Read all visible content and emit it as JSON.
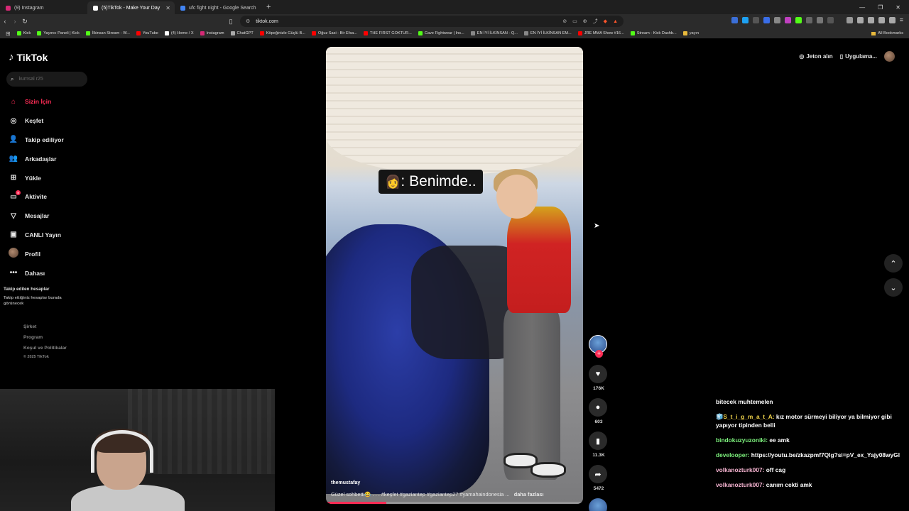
{
  "browser": {
    "tabs": [
      {
        "title": "(9) Instagram",
        "active": false,
        "color": "#d62976"
      },
      {
        "title": "(5)TikTok - Make Your Day",
        "active": true,
        "color": "#ffffff"
      },
      {
        "title": "ufc fight night - Google Search",
        "active": false,
        "color": "#4285f4"
      }
    ],
    "new_tab": "+",
    "url": "tiktok.com",
    "bookmarks": [
      {
        "label": "Kick",
        "color": "#53fc18"
      },
      {
        "label": "Yayıncı Paneli | Kick",
        "color": "#53fc18"
      },
      {
        "label": "İlkinsan Stream - W...",
        "color": "#53fc18"
      },
      {
        "label": "YouTube",
        "color": "#ff0000"
      },
      {
        "label": "(4) Home / X",
        "color": "#ffffff"
      },
      {
        "label": "Instagram",
        "color": "#d62976"
      },
      {
        "label": "ChatGPT",
        "color": "#aaaaaa"
      },
      {
        "label": "Köpeğinizle Güçlü B...",
        "color": "#ff0000"
      },
      {
        "label": "Oğuz Sasi - Bir Efsa...",
        "color": "#ff0000"
      },
      {
        "label": "THE FIRST GOKTUR...",
        "color": "#ff0000"
      },
      {
        "label": "Cave Fightwear | Ins...",
        "color": "#53fc18"
      },
      {
        "label": "EN İYİ İLKİNSAN - Q...",
        "color": "#888888"
      },
      {
        "label": "EN İYİ İLKİNSAN EM...",
        "color": "#888888"
      },
      {
        "label": "JRE MMA Show #16...",
        "color": "#ff0000"
      },
      {
        "label": "Stream - Kick Dashb...",
        "color": "#53fc18"
      },
      {
        "label": "yayın",
        "color": "#e8b93c"
      }
    ],
    "all_bookmarks": "All Bookmarks"
  },
  "sidebar": {
    "logo": "TikTok",
    "search_placeholder": "kumsal r25",
    "items": [
      {
        "label": "Sizin İçin",
        "icon": "home-icon",
        "glyph": "⌂",
        "active": true
      },
      {
        "label": "Keşfet",
        "icon": "compass-icon",
        "glyph": "◎",
        "active": false
      },
      {
        "label": "Takip ediliyor",
        "icon": "following-icon",
        "glyph": "👤",
        "active": false
      },
      {
        "label": "Arkadaşlar",
        "icon": "friends-icon",
        "glyph": "👥",
        "active": false
      },
      {
        "label": "Yükle",
        "icon": "upload-icon",
        "glyph": "⊞",
        "active": false
      },
      {
        "label": "Aktivite",
        "icon": "activity-icon",
        "glyph": "▭",
        "active": false,
        "badge": "5"
      },
      {
        "label": "Mesajlar",
        "icon": "messages-icon",
        "glyph": "▽",
        "active": false
      },
      {
        "label": "CANLI Yayın",
        "icon": "live-icon",
        "glyph": "▣",
        "active": false
      },
      {
        "label": "Profil",
        "icon": "profile-avatar-icon",
        "glyph": "",
        "active": false
      },
      {
        "label": "Dahası",
        "icon": "more-icon",
        "glyph": "•••",
        "active": false
      }
    ],
    "followed_title": "Takip edilen hesaplar",
    "followed_sub": "Takip ettiğiniz hesaplar burada görünecek",
    "footer": [
      "Şirket",
      "Program",
      "Koşul ve Politikalar"
    ],
    "copyright": "© 2025 TikTok"
  },
  "topright": {
    "coins": "Jeton alın",
    "app": "Uygulama..."
  },
  "video": {
    "caption_emoji": "👩",
    "caption": ": Benimde..",
    "author": "themustafay",
    "description": "Güzel sohbetti😂 . . . #keşfet #gaziantep #gaziantep27 #yamahaindonesia ...",
    "more": "daha fazlası",
    "progress": 0.235
  },
  "actions": {
    "likes": "176K",
    "comments": "603",
    "saves": "11.3K",
    "shares": "5472"
  },
  "chat": [
    {
      "user": "",
      "message": "bitecek muhtemelen",
      "color": "#ffffff"
    },
    {
      "user": "🧊S_t_i_g_m_a_t_A:",
      "message": " kız motor sürmeyi biliyor ya bilmiyor gibi yapıyor tipinden belli",
      "color": "#f0d34a"
    },
    {
      "user": "bindokuzyuzoniki:",
      "message": " ee amk",
      "color": "#7cf07c"
    },
    {
      "user": "develooper:",
      "message": " https://youtu.be/zkazpmf7QIg?si=pV_ex_Yajy08wyGl",
      "color": "#7cf07c"
    },
    {
      "user": "volkanozturk007:",
      "message": " off cag",
      "color": "#f5b3d0"
    },
    {
      "user": "volkanozturk007:",
      "message": " canım cekti amk",
      "color": "#f5b3d0"
    }
  ]
}
